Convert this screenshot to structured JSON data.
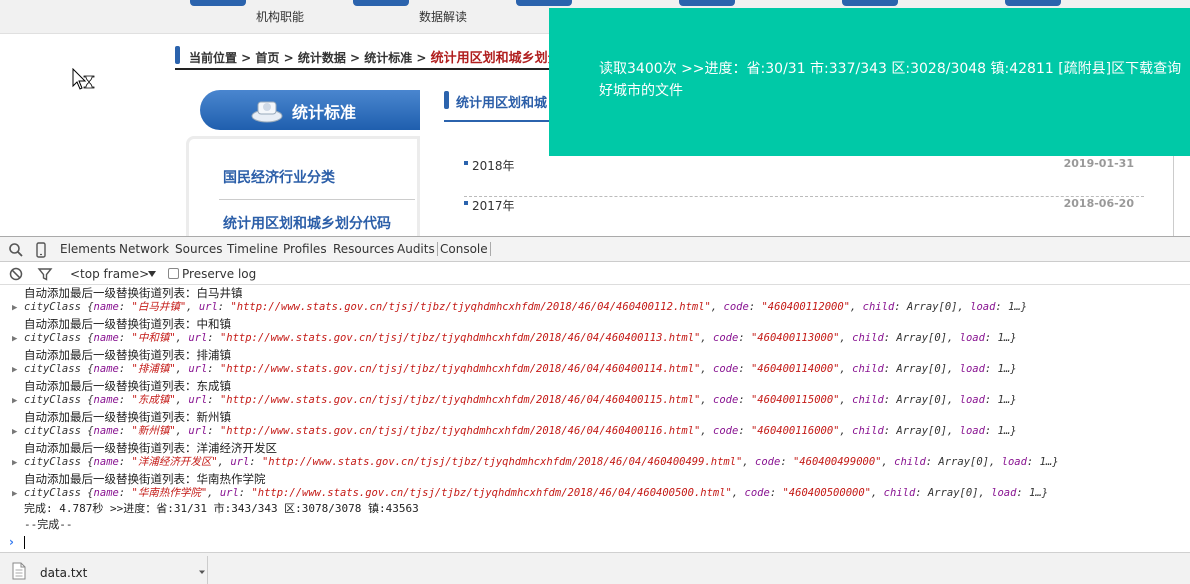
{
  "site": {
    "nav_subs": [
      "机构职能",
      "数据解读"
    ],
    "breadcrumb": {
      "prefix": "当前位置 > 首页 > 统计数据 > 统计标准 > ",
      "current": "统计用区划和城乡划分"
    },
    "banner_title": "统计标准",
    "left_items": [
      "国民经济行业分类",
      "统计用区划和城乡划分代码"
    ],
    "right_heading": "统计用区划和城",
    "rows": [
      {
        "year": "2018年",
        "date": "2019-01-31"
      },
      {
        "year": "2017年",
        "date": "2018-06-20"
      }
    ],
    "toast": "读取3400次 >>进度：省:30/31 市:337/343 区:3028/3048 镇:42811 [疏附县]区下载查询好城市的文件"
  },
  "devtools": {
    "tabs": [
      "Elements",
      "Network",
      "Sources",
      "Timeline",
      "Profiles",
      "Resources",
      "Audits",
      "Console"
    ],
    "frame": "<top frame>",
    "preserve_log": "Preserve log",
    "log_prefix": "自动添加最后一级替换街道列表：",
    "entries": [
      {
        "town": "白马井镇",
        "url": "http://www.stats.gov.cn/tjsj/tjbz/tjyqhdmhcxhfdm/2018/46/04/460400112.html",
        "code": "460400112000"
      },
      {
        "town": "中和镇",
        "url": "http://www.stats.gov.cn/tjsj/tjbz/tjyqhdmhcxhfdm/2018/46/04/460400113.html",
        "code": "460400113000"
      },
      {
        "town": "排浦镇",
        "url": "http://www.stats.gov.cn/tjsj/tjbz/tjyqhdmhcxhfdm/2018/46/04/460400114.html",
        "code": "460400114000"
      },
      {
        "town": "东成镇",
        "url": "http://www.stats.gov.cn/tjsj/tjbz/tjyqhdmhcxhfdm/2018/46/04/460400115.html",
        "code": "460400115000"
      },
      {
        "town": "新州镇",
        "url": "http://www.stats.gov.cn/tjsj/tjbz/tjyqhdmhcxhfdm/2018/46/04/460400116.html",
        "code": "460400116000"
      },
      {
        "town": "洋浦经济开发区",
        "url": "http://www.stats.gov.cn/tjsj/tjbz/tjyqhdmhcxhfdm/2018/46/04/460400499.html",
        "code": "460400499000"
      },
      {
        "town": "华南热作学院",
        "url": "http://www.stats.gov.cn/tjsj/tjbz/tjyqhdmhcxhfdm/2018/46/04/460400500.html",
        "code": "460400500000"
      }
    ],
    "obj_label": "cityClass",
    "obj_tail": "child: Array[0], load: 1…}",
    "done_line": "完成: 4.787秒 >>进度：省:31/31 市:343/343 区:3078/3078 镇:43563",
    "done_end": "--完成--"
  },
  "downloads": {
    "file": "data.txt"
  },
  "colors": {
    "toast": "#00c9a7",
    "accent": "#2b63ad",
    "breadcrumb_current": "#b01e1e",
    "console_key": "#881391",
    "console_string": "#c41a16"
  }
}
